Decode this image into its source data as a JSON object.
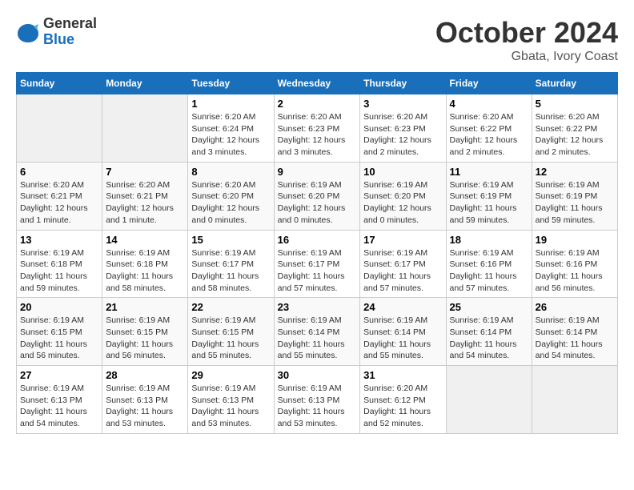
{
  "logo": {
    "general": "General",
    "blue": "Blue"
  },
  "title": "October 2024",
  "location": "Gbata, Ivory Coast",
  "days_header": [
    "Sunday",
    "Monday",
    "Tuesday",
    "Wednesday",
    "Thursday",
    "Friday",
    "Saturday"
  ],
  "weeks": [
    [
      {
        "day": "",
        "info": ""
      },
      {
        "day": "",
        "info": ""
      },
      {
        "day": "1",
        "info": "Sunrise: 6:20 AM\nSunset: 6:24 PM\nDaylight: 12 hours and 3 minutes."
      },
      {
        "day": "2",
        "info": "Sunrise: 6:20 AM\nSunset: 6:23 PM\nDaylight: 12 hours and 3 minutes."
      },
      {
        "day": "3",
        "info": "Sunrise: 6:20 AM\nSunset: 6:23 PM\nDaylight: 12 hours and 2 minutes."
      },
      {
        "day": "4",
        "info": "Sunrise: 6:20 AM\nSunset: 6:22 PM\nDaylight: 12 hours and 2 minutes."
      },
      {
        "day": "5",
        "info": "Sunrise: 6:20 AM\nSunset: 6:22 PM\nDaylight: 12 hours and 2 minutes."
      }
    ],
    [
      {
        "day": "6",
        "info": "Sunrise: 6:20 AM\nSunset: 6:21 PM\nDaylight: 12 hours and 1 minute."
      },
      {
        "day": "7",
        "info": "Sunrise: 6:20 AM\nSunset: 6:21 PM\nDaylight: 12 hours and 1 minute."
      },
      {
        "day": "8",
        "info": "Sunrise: 6:20 AM\nSunset: 6:20 PM\nDaylight: 12 hours and 0 minutes."
      },
      {
        "day": "9",
        "info": "Sunrise: 6:19 AM\nSunset: 6:20 PM\nDaylight: 12 hours and 0 minutes."
      },
      {
        "day": "10",
        "info": "Sunrise: 6:19 AM\nSunset: 6:20 PM\nDaylight: 12 hours and 0 minutes."
      },
      {
        "day": "11",
        "info": "Sunrise: 6:19 AM\nSunset: 6:19 PM\nDaylight: 11 hours and 59 minutes."
      },
      {
        "day": "12",
        "info": "Sunrise: 6:19 AM\nSunset: 6:19 PM\nDaylight: 11 hours and 59 minutes."
      }
    ],
    [
      {
        "day": "13",
        "info": "Sunrise: 6:19 AM\nSunset: 6:18 PM\nDaylight: 11 hours and 59 minutes."
      },
      {
        "day": "14",
        "info": "Sunrise: 6:19 AM\nSunset: 6:18 PM\nDaylight: 11 hours and 58 minutes."
      },
      {
        "day": "15",
        "info": "Sunrise: 6:19 AM\nSunset: 6:17 PM\nDaylight: 11 hours and 58 minutes."
      },
      {
        "day": "16",
        "info": "Sunrise: 6:19 AM\nSunset: 6:17 PM\nDaylight: 11 hours and 57 minutes."
      },
      {
        "day": "17",
        "info": "Sunrise: 6:19 AM\nSunset: 6:17 PM\nDaylight: 11 hours and 57 minutes."
      },
      {
        "day": "18",
        "info": "Sunrise: 6:19 AM\nSunset: 6:16 PM\nDaylight: 11 hours and 57 minutes."
      },
      {
        "day": "19",
        "info": "Sunrise: 6:19 AM\nSunset: 6:16 PM\nDaylight: 11 hours and 56 minutes."
      }
    ],
    [
      {
        "day": "20",
        "info": "Sunrise: 6:19 AM\nSunset: 6:15 PM\nDaylight: 11 hours and 56 minutes."
      },
      {
        "day": "21",
        "info": "Sunrise: 6:19 AM\nSunset: 6:15 PM\nDaylight: 11 hours and 56 minutes."
      },
      {
        "day": "22",
        "info": "Sunrise: 6:19 AM\nSunset: 6:15 PM\nDaylight: 11 hours and 55 minutes."
      },
      {
        "day": "23",
        "info": "Sunrise: 6:19 AM\nSunset: 6:14 PM\nDaylight: 11 hours and 55 minutes."
      },
      {
        "day": "24",
        "info": "Sunrise: 6:19 AM\nSunset: 6:14 PM\nDaylight: 11 hours and 55 minutes."
      },
      {
        "day": "25",
        "info": "Sunrise: 6:19 AM\nSunset: 6:14 PM\nDaylight: 11 hours and 54 minutes."
      },
      {
        "day": "26",
        "info": "Sunrise: 6:19 AM\nSunset: 6:14 PM\nDaylight: 11 hours and 54 minutes."
      }
    ],
    [
      {
        "day": "27",
        "info": "Sunrise: 6:19 AM\nSunset: 6:13 PM\nDaylight: 11 hours and 54 minutes."
      },
      {
        "day": "28",
        "info": "Sunrise: 6:19 AM\nSunset: 6:13 PM\nDaylight: 11 hours and 53 minutes."
      },
      {
        "day": "29",
        "info": "Sunrise: 6:19 AM\nSunset: 6:13 PM\nDaylight: 11 hours and 53 minutes."
      },
      {
        "day": "30",
        "info": "Sunrise: 6:19 AM\nSunset: 6:13 PM\nDaylight: 11 hours and 53 minutes."
      },
      {
        "day": "31",
        "info": "Sunrise: 6:20 AM\nSunset: 6:12 PM\nDaylight: 11 hours and 52 minutes."
      },
      {
        "day": "",
        "info": ""
      },
      {
        "day": "",
        "info": ""
      }
    ]
  ]
}
